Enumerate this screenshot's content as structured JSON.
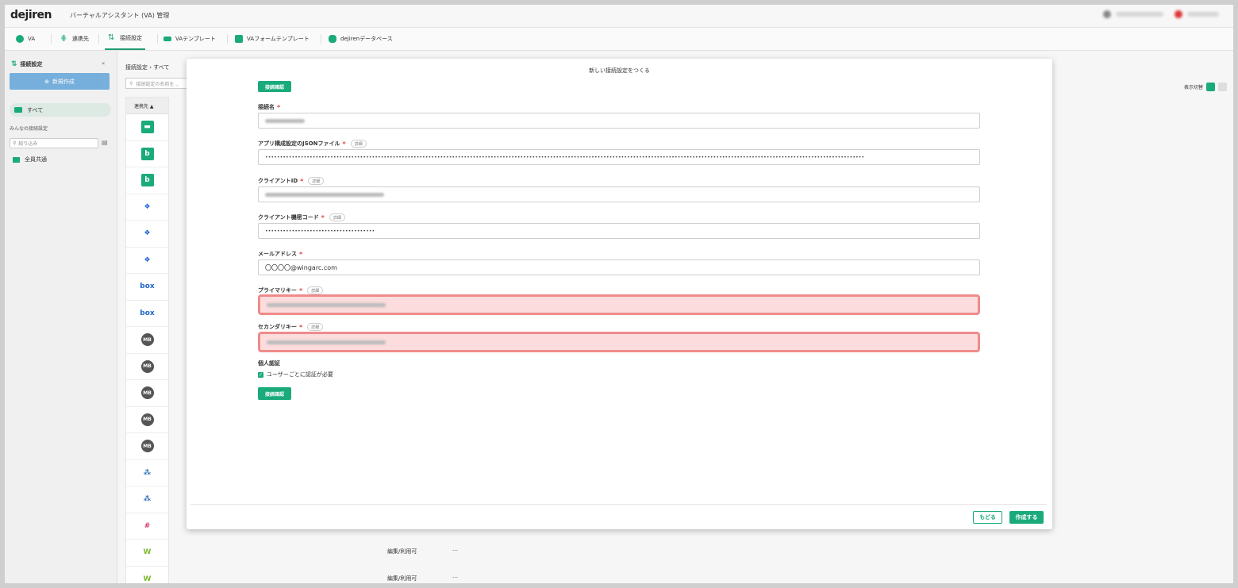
{
  "header": {
    "logo": "dejiren",
    "title": "バーチャルアシスタント (VA) 管理"
  },
  "nav": {
    "tabs": [
      {
        "label": "VA",
        "icon": "va-icon",
        "color": "#1aaa7b"
      },
      {
        "label": "連携先",
        "icon": "link-icon",
        "color": "#1aaa7b"
      },
      {
        "label": "接続設定",
        "icon": "connection-icon",
        "color": "#1aaa7b",
        "active": true
      },
      {
        "label": "VAテンプレート",
        "icon": "template-icon",
        "color": "#1aaa7b"
      },
      {
        "label": "VAフォームテンプレート",
        "icon": "form-template-icon",
        "color": "#1aaa7b"
      },
      {
        "label": "dejirenデータベース",
        "icon": "database-icon",
        "color": "#1aaa7b"
      }
    ]
  },
  "sidebar": {
    "title": "接続設定",
    "new_button": "新規作成",
    "all_label": "すべて",
    "section_label": "みんなの接続設定",
    "filter_placeholder": "絞り込み",
    "group_label": "全員共通"
  },
  "main": {
    "breadcrumb": "接続設定 › すべて",
    "search_placeholder": "接続設定の名前を...",
    "column_header": "連携先 ▲",
    "view_toggle_label": "表示切替",
    "services": [
      "chat",
      "b",
      "b",
      "dropbox",
      "dropbox",
      "dropbox",
      "box",
      "box",
      "MB",
      "MB",
      "MB",
      "MB",
      "MB",
      "cluster",
      "cluster",
      "slack",
      "W",
      "W"
    ],
    "row_permission": "編集/利用可",
    "row_menu": "…"
  },
  "modal": {
    "title": "新しい接続設定をつくる",
    "test_button": "接続確認",
    "detail_label": "詳細",
    "fields": {
      "name": {
        "label": "接続名",
        "required": "*"
      },
      "json": {
        "label": "アプリ構成設定のJSONファイル",
        "required": "*",
        "value": "••••••••••••••••••••••••••••••••••••••••••••••••••••••••••••••••••••••••••••••••••••••••••••••••••••••••••••••••••••••••••••••••••••••••••••••••••••••••••••••••••••••••••••••••••••••••••••••••••••••••••"
      },
      "client_id": {
        "label": "クライアントID",
        "required": "*"
      },
      "client_secret": {
        "label": "クライアント機密コード",
        "required": "*",
        "value": "•••••••••••••••••••••••••••••••••••••"
      },
      "email": {
        "label": "メールアドレス",
        "required": "*",
        "value": "〇〇〇〇@wingarc.com"
      },
      "primary_key": {
        "label": "プライマリキー",
        "required": "*"
      },
      "secondary_key": {
        "label": "セカンダリキー",
        "required": "*"
      }
    },
    "auth_section": "個人認証",
    "auth_checkbox": "ユーザーごとに認証が必要",
    "back_button": "もどる",
    "create_button": "作成する",
    "accent_color": "#1aaa7b",
    "error_color": "#f08b8b"
  }
}
